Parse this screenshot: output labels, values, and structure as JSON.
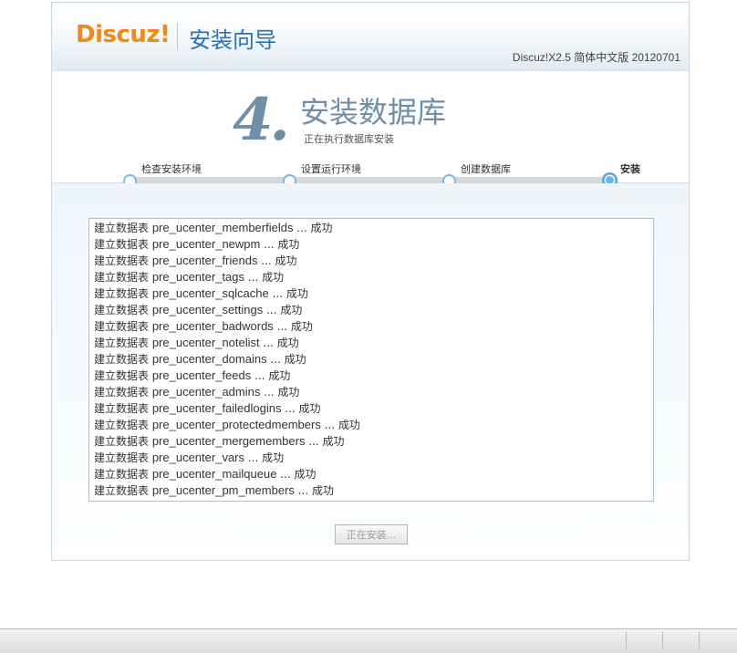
{
  "header": {
    "logo_text": "Discuz!",
    "wizard_title": "安装向导",
    "version": "Discuz!X2.5 简体中文版 20120701"
  },
  "step": {
    "number": "4.",
    "title": "安装数据库",
    "subtitle": "正在执行数据库安装"
  },
  "progress": {
    "current_step": 4,
    "total_steps": 4,
    "steps": [
      {
        "label": "检查安装环境"
      },
      {
        "label": "设置运行环境"
      },
      {
        "label": "创建数据库"
      },
      {
        "label": "安装"
      }
    ]
  },
  "log": {
    "prefix": "建立数据表",
    "suffix": "... 成功",
    "tables": [
      "pre_ucenter_memberfields",
      "pre_ucenter_newpm",
      "pre_ucenter_friends",
      "pre_ucenter_tags",
      "pre_ucenter_sqlcache",
      "pre_ucenter_settings",
      "pre_ucenter_badwords",
      "pre_ucenter_notelist",
      "pre_ucenter_domains",
      "pre_ucenter_feeds",
      "pre_ucenter_admins",
      "pre_ucenter_failedlogins",
      "pre_ucenter_protectedmembers",
      "pre_ucenter_mergemembers",
      "pre_ucenter_vars",
      "pre_ucenter_mailqueue",
      "pre_ucenter_pm_members"
    ]
  },
  "button": {
    "label": "正在安装..."
  },
  "colors": {
    "logo": "#ed8a1d",
    "title_blue": "#2872b8",
    "step_gray_blue": "#6f8ea8"
  }
}
